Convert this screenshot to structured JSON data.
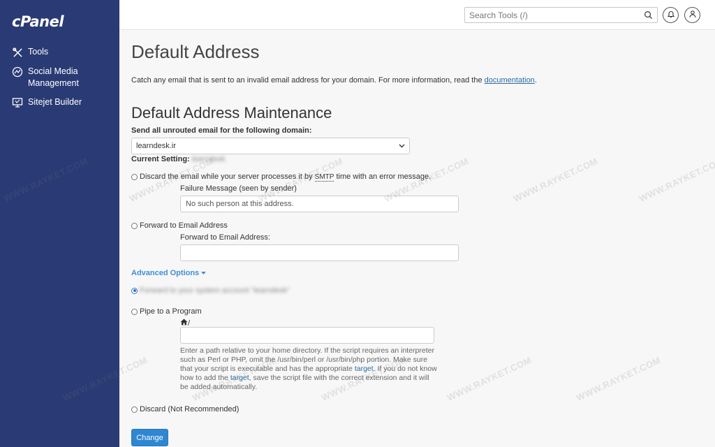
{
  "app": {
    "logo": "cPanel"
  },
  "sidebar": {
    "items": [
      {
        "label": "Tools",
        "icon": "tools-icon"
      },
      {
        "label": "Social Media Management",
        "icon": "social-media-icon"
      },
      {
        "label": "Sitejet Builder",
        "icon": "sitejet-icon"
      }
    ]
  },
  "topbar": {
    "search_placeholder": "Search Tools (/)",
    "icons": [
      "search-icon",
      "bell-icon",
      "user-icon"
    ]
  },
  "page": {
    "title": "Default Address",
    "intro": "Catch any email that is sent to an invalid email address for your domain. For more information, read the ",
    "intro_link": "documentation",
    "intro_end": ".",
    "section_title": "Default Address Maintenance",
    "domain_label": "Send all unrouted email for the following domain:",
    "domain_value": "learndesk.ir",
    "current_setting_label": "Current Setting:",
    "current_setting_value": "learndesk",
    "options": {
      "discard_prefix": "Discard the email while your server processes it by ",
      "discard_smtp": "SMTP",
      "discard_suffix": " time with an error message.",
      "failure_label": "Failure Message (seen by sender)",
      "failure_value": "No such person at this address.",
      "forward_label": "Forward to Email Address",
      "forward_field_label": "Forward to Email Address:",
      "forward_value": "",
      "advanced_label": "Advanced Options",
      "system_account_label": "Forward to your system account \"learndesk\"",
      "pipe_label": "Pipe to a Program",
      "pipe_prefix": "/",
      "pipe_value": "",
      "discard_nr_label": "Discard (Not Recommended)"
    },
    "help": {
      "p1": "Enter a path relative to your home directory. If the script requires an interpreter such as Perl or PHP, omit the /usr/bin/perl or /usr/bin/php portion. Make sure that your script is executable and has the appropriate ",
      "link1": "target",
      "p2": ". If you do not know how to add the ",
      "link2": "target",
      "p3": ", save the script file with the correct extension and it will be added automatically."
    },
    "change_button": "Change"
  },
  "watermark": "WWW.RAYKET.COM",
  "colors": {
    "sidebar_bg": "#293a74",
    "accent": "#2f86d1",
    "link": "#2d6ca2"
  }
}
